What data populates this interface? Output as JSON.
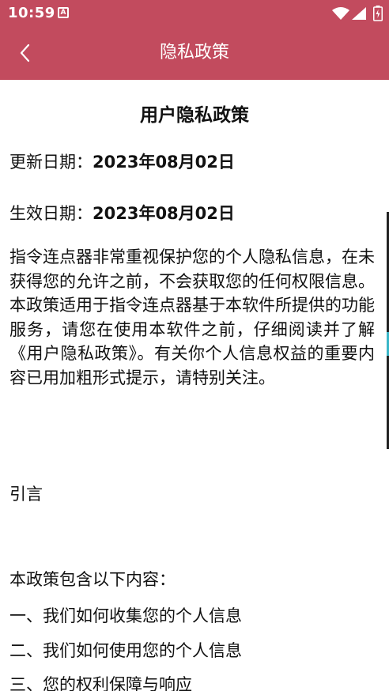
{
  "status_bar": {
    "time": "10:59",
    "notification_glyph": "A"
  },
  "app_bar": {
    "title": "隐私政策"
  },
  "document": {
    "title": "用户隐私政策",
    "updated_label": "更新日期：",
    "updated_value": "2023年08月02日",
    "effective_label": "生效日期：",
    "effective_value": "2023年08月02日",
    "intro": "指令连点器非常重视保护您的个人隐私信息，在未获得您的允许之前，不会获取您的任何权限信息。本政策适用于指令连点器基于本软件所提供的功能服务，请您在使用本软件之前，仔细阅读并了解《用户隐私政策》。有关你个人信息权益的重要内容已用加粗形式提示，请特别关注。",
    "section_heading": "引言",
    "contents_intro": "本政策包含以下内容：",
    "contents_items": [
      "一、我们如何收集您的个人信息",
      "二、我们如何使用您的个人信息",
      "三、您的权利保障与响应"
    ]
  },
  "colors": {
    "header_bg": "#c24b5e",
    "header_text": "#ffffff",
    "body_text": "#111111"
  }
}
